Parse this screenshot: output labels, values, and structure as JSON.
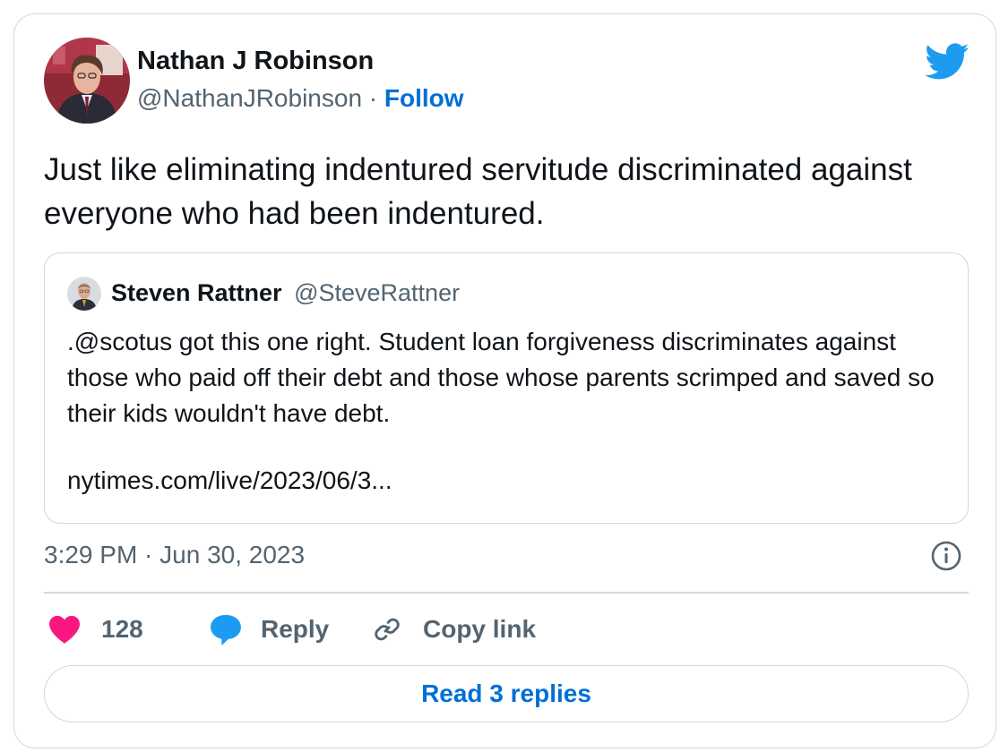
{
  "tweet": {
    "author": {
      "name": "Nathan J Robinson",
      "handle": "@NathanJRobinson",
      "separator": "·",
      "follow_label": "Follow"
    },
    "text": "Just like eliminating indentured servitude discriminated against everyone who had been indentured.",
    "quoted": {
      "name": "Steven Rattner",
      "handle": "@SteveRattner",
      "text": ".@scotus got this one right. Student loan forgiveness discriminates against those who paid off their debt and those whose parents scrimped and saved so their kids wouldn't have debt.",
      "link": "nytimes.com/live/2023/06/3..."
    },
    "timestamp": "3:29 PM · Jun 30, 2023",
    "actions": {
      "likes": "128",
      "reply_label": "Reply",
      "copy_link_label": "Copy link"
    },
    "read_replies_label": "Read 3 replies"
  },
  "icons": {
    "brand": "twitter-bird-icon",
    "info": "info-icon",
    "like": "heart-icon",
    "reply": "speech-bubble-icon",
    "copy_link": "link-icon"
  },
  "colors": {
    "twitter_blue": "#1d9bf0",
    "link_blue": "#006fd6",
    "like_pink": "#f91880",
    "secondary_text": "#536471",
    "border": "#cfd9de"
  }
}
